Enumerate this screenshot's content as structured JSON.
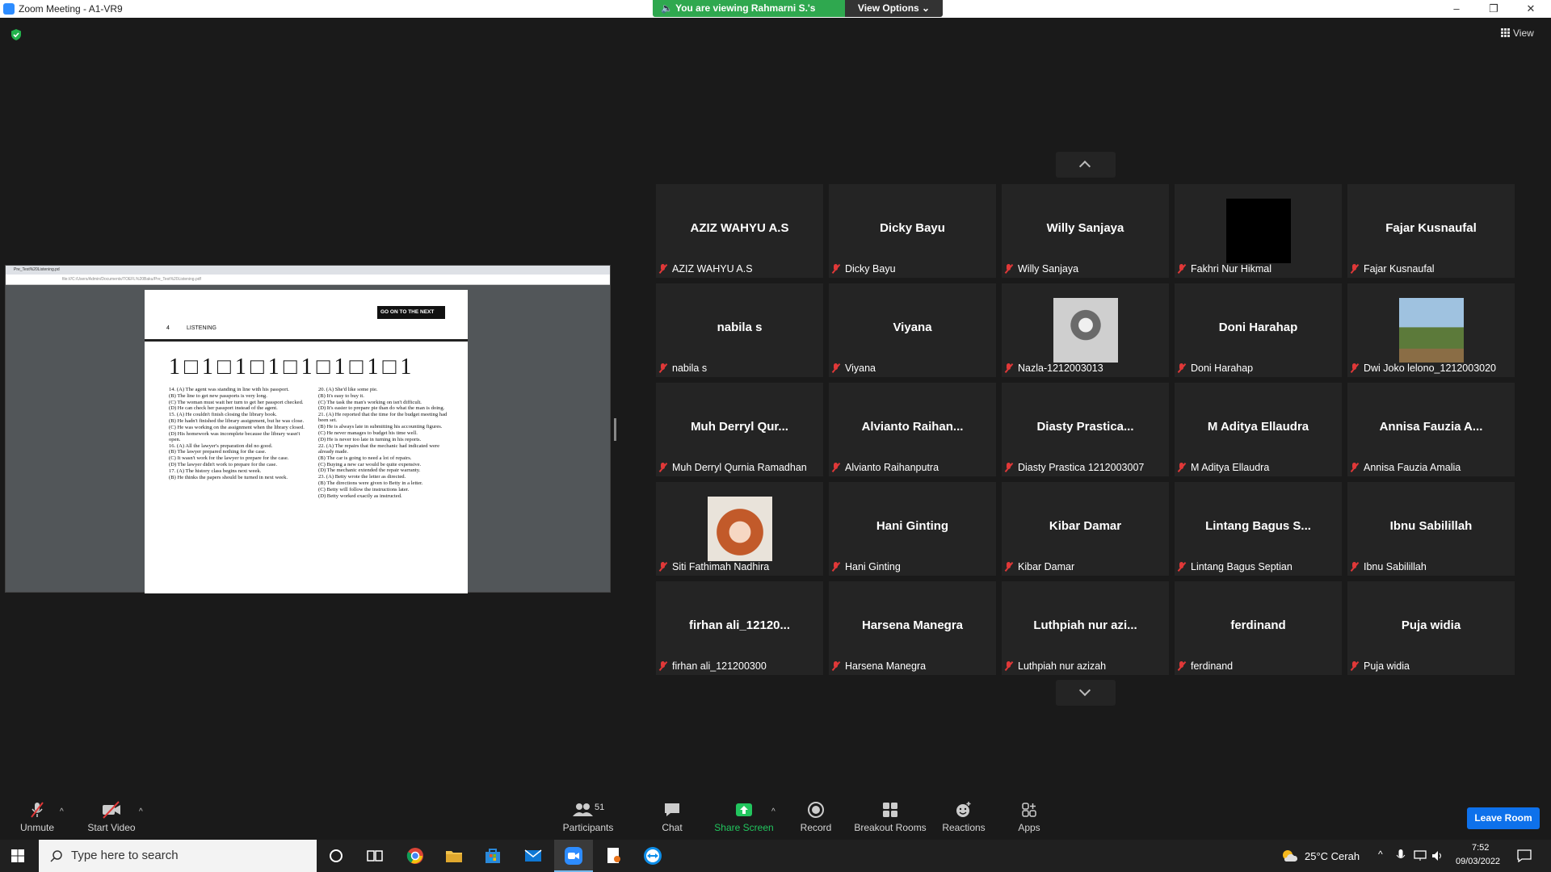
{
  "window": {
    "title": "Zoom Meeting - A1-VR9"
  },
  "banner": {
    "viewing_text": "You are viewing Rahmarni S.'s screen",
    "view_options": "View Options ⌄"
  },
  "view_button": "View",
  "shared_doc": {
    "tab": "Pre_Test%20Listening.pd",
    "url": "file:///C:/Users/Admin/Documents/TOEFL%20Baku/Pre_Test%20Listening.pdf",
    "page_number": "4",
    "section": "LISTENING",
    "next_page": "GO ON TO THE NEXT PAGE",
    "digits": "1□1□1□1□1□1□1□1",
    "left_col": [
      "14. (A) The agent was standing in line with his passport.",
      "(B) The line to get new passports is very long.",
      "(C) The woman must wait her turn to get her passport checked.",
      "(D) He can check her passport instead of the agent.",
      "15. (A) He couldn't finish closing the library book.",
      "(B) He hadn't finished the library assignment, but he was close.",
      "(C) He was working on the assignment when the library closed.",
      "(D) His homework was incomplete because the library wasn't open.",
      "16. (A) All the lawyer's preparation did no good.",
      "(B) The lawyer prepared nothing for the case.",
      "(C) It wasn't work for the lawyer to prepare for the case.",
      "(D) The lawyer didn't work to prepare for the case.",
      "17. (A) The history class begins next week.",
      "(B) He thinks the papers should be turned in next week."
    ],
    "right_col": [
      "20. (A) She'd like some pie.",
      "(B) It's easy to buy it.",
      "(C) The task the man's working on isn't difficult.",
      "(D) It's easier to prepare pie than do what the man is doing.",
      "21. (A) He reported that the time for the budget meeting had been set.",
      "(B) He is always late in submitting his accounting figures.",
      "(C) He never manages to budget his time well.",
      "(D) He is never too late in turning in his reports.",
      "22. (A) The repairs that the mechanic had indicated were already made.",
      "(B) The car is going to need a lot of repairs.",
      "(C) Buying a new car would be quite expensive.",
      "(D) The mechanic extended the repair warranty.",
      "23. (A) Betty wrote the letter as directed.",
      "(B) The directions were given to Betty in a letter.",
      "(C) Betty will follow the instructions later.",
      "(D) Betty worked exactly as instructed."
    ]
  },
  "participants": [
    {
      "display": "AZIZ WAHYU A.S",
      "name": "AZIZ WAHYU A.S",
      "pic": ""
    },
    {
      "display": "Dicky Bayu",
      "name": "Dicky Bayu",
      "pic": ""
    },
    {
      "display": "Willy Sanjaya",
      "name": "Willy Sanjaya",
      "pic": ""
    },
    {
      "display": "",
      "name": "Fakhri Nur Hikmal",
      "pic": "black"
    },
    {
      "display": "Fajar Kusnaufal",
      "name": "Fajar Kusnaufal",
      "pic": ""
    },
    {
      "display": "nabila s",
      "name": "nabila s",
      "pic": ""
    },
    {
      "display": "Viyana",
      "name": "Viyana",
      "pic": ""
    },
    {
      "display": "",
      "name": "Nazla-1212003013",
      "pic": "photo-bw"
    },
    {
      "display": "Doni Harahap",
      "name": "Doni Harahap",
      "pic": ""
    },
    {
      "display": "",
      "name": "Dwi Joko lelono_1212003020",
      "pic": "photo-outdoor"
    },
    {
      "display": "Muh  Derryl  Qur...",
      "name": "Muh Derryl Qurnia Ramadhan",
      "pic": ""
    },
    {
      "display": "Alvianto  Raihan...",
      "name": "Alvianto Raihanputra",
      "pic": ""
    },
    {
      "display": "Diasty  Prastica...",
      "name": "Diasty Prastica 1212003007",
      "pic": ""
    },
    {
      "display": "M Aditya Ellaudra",
      "name": "M Aditya Ellaudra",
      "pic": ""
    },
    {
      "display": "Annisa Fauzia A...",
      "name": "Annisa Fauzia Amalia",
      "pic": ""
    },
    {
      "display": "",
      "name": "Siti Fathimah Nadhira",
      "pic": "anime"
    },
    {
      "display": "Hani Ginting",
      "name": "Hani Ginting",
      "pic": ""
    },
    {
      "display": "Kibar Damar",
      "name": "Kibar Damar",
      "pic": ""
    },
    {
      "display": "Lintang  Bagus  S...",
      "name": "Lintang Bagus Septian",
      "pic": ""
    },
    {
      "display": "Ibnu Sabilillah",
      "name": "Ibnu Sabilillah",
      "pic": ""
    },
    {
      "display": "firhan ali_12120...",
      "name": "firhan ali_121200300",
      "pic": ""
    },
    {
      "display": "Harsena Manegra",
      "name": "Harsena Manegra",
      "pic": ""
    },
    {
      "display": "Luthpiah  nur  azi...",
      "name": "Luthpiah nur azizah",
      "pic": ""
    },
    {
      "display": "ferdinand",
      "name": "ferdinand",
      "pic": ""
    },
    {
      "display": "Puja widia",
      "name": "Puja widia",
      "pic": ""
    }
  ],
  "toolbar": {
    "unmute": "Unmute",
    "start_video": "Start Video",
    "participants": "Participants",
    "participant_count": "51",
    "chat": "Chat",
    "share_screen": "Share Screen",
    "record": "Record",
    "breakout_rooms": "Breakout Rooms",
    "reactions": "Reactions",
    "apps": "Apps",
    "leave": "Leave Room"
  },
  "taskbar": {
    "search_placeholder": "Type here to search",
    "weather": "25°C  Cerah",
    "time": "7:52",
    "date": "09/03/2022"
  },
  "colors": {
    "banner_green": "#2fa84f",
    "leave_blue": "#0e71eb",
    "share_green": "#22c55e",
    "mute_red": "#e03838"
  }
}
